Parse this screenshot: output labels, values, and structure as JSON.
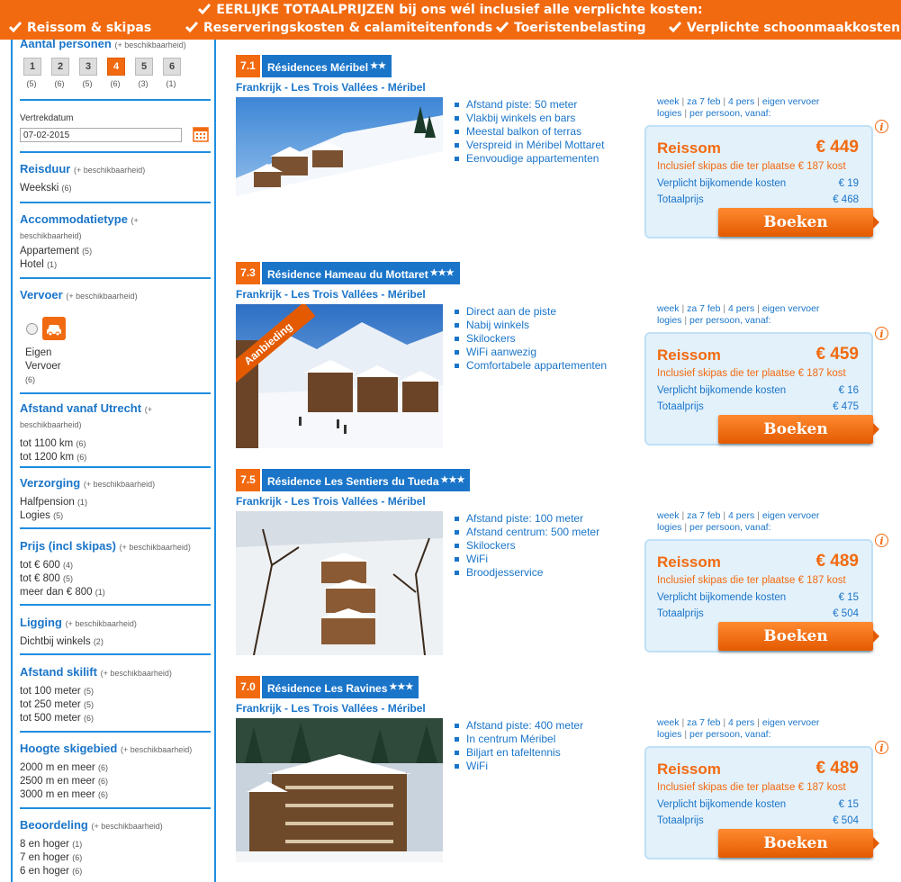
{
  "banner": {
    "headline": "EERLIJKE TOTAALPRIJZEN bij ons wél inclusief alle verplichte kosten:",
    "items": [
      "Reissom & skipas",
      "Reserveringskosten & calamiteitenfonds",
      "Toeristenbelasting",
      "Verplichte schoonmaakkosten"
    ]
  },
  "sidebar": {
    "persons": {
      "title": "Aantal personen",
      "hint": "(+ beschikbaarheid)",
      "options": [
        {
          "label": "1",
          "count": "(5)"
        },
        {
          "label": "2",
          "count": "(6)"
        },
        {
          "label": "3",
          "count": "(5)"
        },
        {
          "label": "4",
          "count": "(6)"
        },
        {
          "label": "5",
          "count": "(3)"
        },
        {
          "label": "6",
          "count": "(1)"
        }
      ],
      "selected": "4"
    },
    "date": {
      "label": "Vertrekdatum",
      "value": "07-02-2015"
    },
    "reisduur": {
      "title": "Reisduur",
      "hint": "(+ beschikbaarheid)",
      "options": [
        {
          "label": "Weekski",
          "count": "(6)"
        }
      ]
    },
    "accommodatie": {
      "title": "Accommodatietype",
      "hint": "(+ beschikbaarheid)",
      "options": [
        {
          "label": "Appartement",
          "count": "(5)"
        },
        {
          "label": "Hotel",
          "count": "(1)"
        }
      ]
    },
    "vervoer": {
      "title": "Vervoer",
      "hint": "(+ beschikbaarheid)",
      "label1": "Eigen",
      "label2": "Vervoer",
      "count": "(6)"
    },
    "afstand": {
      "title": "Afstand vanaf Utrecht",
      "hint": "(+ beschikbaarheid)",
      "options": [
        {
          "label": "tot 1100 km",
          "count": "(6)"
        },
        {
          "label": "tot 1200 km",
          "count": "(6)"
        }
      ]
    },
    "verzorging": {
      "title": "Verzorging",
      "hint": "(+ beschikbaarheid)",
      "options": [
        {
          "label": "Halfpension",
          "count": "(1)"
        },
        {
          "label": "Logies",
          "count": "(5)"
        }
      ]
    },
    "prijs": {
      "title": "Prijs (incl skipas)",
      "hint": "(+ beschikbaarheid)",
      "options": [
        {
          "label": "tot € 600",
          "count": "(4)"
        },
        {
          "label": "tot € 800",
          "count": "(5)"
        },
        {
          "label": "meer dan € 800",
          "count": "(1)"
        }
      ]
    },
    "ligging": {
      "title": "Ligging",
      "hint": "(+ beschikbaarheid)",
      "options": [
        {
          "label": "Dichtbij winkels",
          "count": "(2)"
        }
      ]
    },
    "skilift": {
      "title": "Afstand skilift",
      "hint": "(+ beschikbaarheid)",
      "options": [
        {
          "label": "tot 100 meter",
          "count": "(5)"
        },
        {
          "label": "tot 250 meter",
          "count": "(5)"
        },
        {
          "label": "tot 500 meter",
          "count": "(6)"
        }
      ]
    },
    "hoogte": {
      "title": "Hoogte skigebied",
      "hint": "(+ beschikbaarheid)",
      "options": [
        {
          "label": "2000 m en meer",
          "count": "(6)"
        },
        {
          "label": "2500 m en meer",
          "count": "(6)"
        },
        {
          "label": "3000 m en meer",
          "count": "(6)"
        }
      ]
    },
    "beoordeling": {
      "title": "Beoordeling",
      "hint": "(+ beschikbaarheid)",
      "options": [
        {
          "label": "8 en hoger",
          "count": "(1)"
        },
        {
          "label": "7 en hoger",
          "count": "(6)"
        },
        {
          "label": "6 en hoger",
          "count": "(6)"
        }
      ]
    }
  },
  "results": [
    {
      "score": "7.1",
      "name": "Résidences Méribel",
      "stars": "★★",
      "region": "Frankrijk - Les Trois Vallées - Méribel",
      "features": [
        "Afstand piste: 50 meter",
        "Vlakbij winkels en bars",
        "Meestal balkon of terras",
        "Verspreid in Méribel Mottaret",
        "Eenvoudige appartementen"
      ],
      "meta": {
        "week": "week",
        "date": "za 7 feb",
        "pers": "4 pers",
        "vervoer": "eigen vervoer",
        "logies": "logies",
        "pp": "per persoon, vanaf:"
      },
      "reissom_label": "Reissom",
      "price": "€ 449",
      "skipas": "Inclusief skipas die ter plaatse € 187 kost",
      "extra_label": "Verplicht bijkomende kosten",
      "extra": "€ 19",
      "total_label": "Totaalprijs",
      "total": "€ 468",
      "book": "Boeken",
      "badge": ""
    },
    {
      "score": "7.3",
      "name": "Résidence Hameau du Mottaret",
      "stars": "★★★",
      "region": "Frankrijk - Les Trois Vallées - Méribel",
      "features": [
        "Direct aan de piste",
        "Nabij winkels",
        "Skilockers",
        "WiFi aanwezig",
        "Comfortabele appartementen"
      ],
      "meta": {
        "week": "week",
        "date": "za 7 feb",
        "pers": "4 pers",
        "vervoer": "eigen vervoer",
        "logies": "logies",
        "pp": "per persoon, vanaf:"
      },
      "reissom_label": "Reissom",
      "price": "€ 459",
      "skipas": "Inclusief skipas die ter plaatse € 187 kost",
      "extra_label": "Verplicht bijkomende kosten",
      "extra": "€ 16",
      "total_label": "Totaalprijs",
      "total": "€ 475",
      "book": "Boeken",
      "badge": "Aanbieding"
    },
    {
      "score": "7.5",
      "name": "Résidence Les Sentiers du Tueda",
      "stars": "★★★",
      "region": "Frankrijk - Les Trois Vallées - Méribel",
      "features": [
        "Afstand piste: 100 meter",
        "Afstand centrum: 500 meter",
        "Skilockers",
        "WiFi",
        "Broodjesservice"
      ],
      "meta": {
        "week": "week",
        "date": "za 7 feb",
        "pers": "4 pers",
        "vervoer": "eigen vervoer",
        "logies": "logies",
        "pp": "per persoon, vanaf:"
      },
      "reissom_label": "Reissom",
      "price": "€ 489",
      "skipas": "Inclusief skipas die ter plaatse € 187 kost",
      "extra_label": "Verplicht bijkomende kosten",
      "extra": "€ 15",
      "total_label": "Totaalprijs",
      "total": "€ 504",
      "book": "Boeken",
      "badge": ""
    },
    {
      "score": "7.0",
      "name": "Résidence Les Ravines",
      "stars": "★★★",
      "region": "Frankrijk - Les Trois Vallées - Méribel",
      "features": [
        "Afstand piste: 400 meter",
        "In centrum Méribel",
        "Biljart en tafeltennis",
        "WiFi"
      ],
      "meta": {
        "week": "week",
        "date": "za 7 feb",
        "pers": "4 pers",
        "vervoer": "eigen vervoer",
        "logies": "logies",
        "pp": "per persoon, vanaf:"
      },
      "reissom_label": "Reissom",
      "price": "€ 489",
      "skipas": "Inclusief skipas die ter plaatse € 187 kost",
      "extra_label": "Verplicht bijkomende kosten",
      "extra": "€ 15",
      "total_label": "Totaalprijs",
      "total": "€ 504",
      "book": "Boeken",
      "badge": ""
    }
  ]
}
